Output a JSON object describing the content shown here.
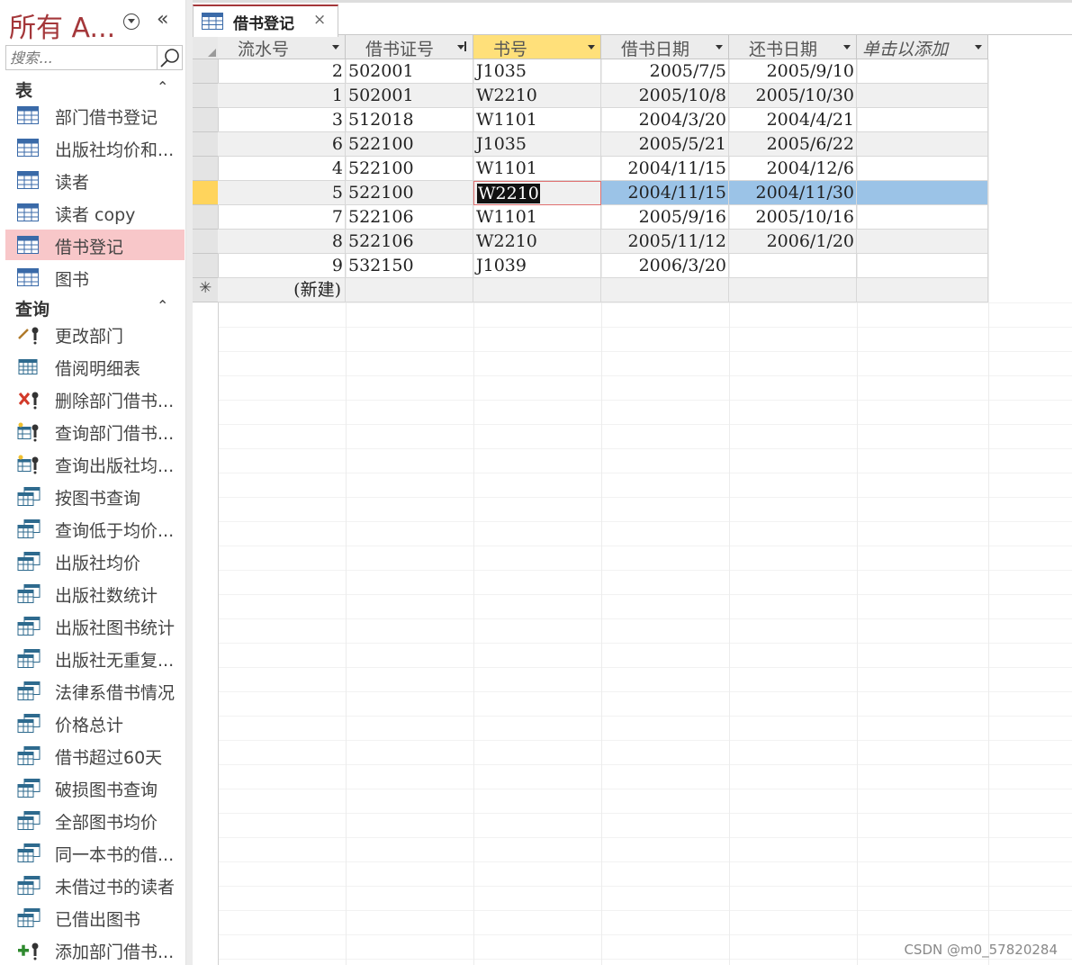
{
  "nav": {
    "title": "所有 A...",
    "search_placeholder": "搜索...",
    "sections": {
      "tables_label": "表",
      "queries_label": "查询"
    },
    "tables": [
      {
        "label": "部门借书登记"
      },
      {
        "label": "出版社均价和..."
      },
      {
        "label": "读者"
      },
      {
        "label": "读者 copy"
      },
      {
        "label": "借书登记",
        "selected": true
      },
      {
        "label": "图书"
      }
    ],
    "queries": [
      {
        "label": "更改部门",
        "icon": "update-query-icon"
      },
      {
        "label": "借阅明细表",
        "icon": "crosstab-query-icon"
      },
      {
        "label": "删除部门借书...",
        "icon": "delete-query-icon"
      },
      {
        "label": "查询部门借书...",
        "icon": "make-table-query-icon"
      },
      {
        "label": "查询出版社均...",
        "icon": "make-table-query-icon"
      },
      {
        "label": "按图书查询",
        "icon": "select-query-icon"
      },
      {
        "label": "查询低于均价...",
        "icon": "select-query-icon"
      },
      {
        "label": "出版社均价",
        "icon": "select-query-icon"
      },
      {
        "label": "出版社数统计",
        "icon": "select-query-icon"
      },
      {
        "label": "出版社图书统计",
        "icon": "select-query-icon"
      },
      {
        "label": "出版社无重复...",
        "icon": "select-query-icon"
      },
      {
        "label": "法律系借书情况",
        "icon": "select-query-icon"
      },
      {
        "label": "价格总计",
        "icon": "select-query-icon"
      },
      {
        "label": "借书超过60天",
        "icon": "select-query-icon"
      },
      {
        "label": "破损图书查询",
        "icon": "select-query-icon"
      },
      {
        "label": "全部图书均价",
        "icon": "select-query-icon"
      },
      {
        "label": "同一本书的借...",
        "icon": "select-query-icon"
      },
      {
        "label": "未借过书的读者",
        "icon": "select-query-icon"
      },
      {
        "label": "已借出图书",
        "icon": "select-query-icon"
      },
      {
        "label": "添加部门借书...",
        "icon": "append-query-icon"
      }
    ]
  },
  "tab": {
    "label": "借书登记",
    "close": "×"
  },
  "datasheet": {
    "columns": [
      "流水号",
      "借书证号",
      "书号",
      "借书日期",
      "还书日期",
      "单击以添加"
    ],
    "rows": [
      [
        "2",
        "502001",
        "J1035",
        "2005/7/5",
        "2005/9/10"
      ],
      [
        "1",
        "502001",
        "W2210",
        "2005/10/8",
        "2005/10/30"
      ],
      [
        "3",
        "512018",
        "W1101",
        "2004/3/20",
        "2004/4/21"
      ],
      [
        "6",
        "522100",
        "J1035",
        "2005/5/21",
        "2005/6/22"
      ],
      [
        "4",
        "522100",
        "W1101",
        "2004/11/15",
        "2004/12/6"
      ],
      [
        "5",
        "522100",
        "W2210",
        "2004/11/15",
        "2004/11/30"
      ],
      [
        "7",
        "522106",
        "W1101",
        "2005/9/16",
        "2005/10/16"
      ],
      [
        "8",
        "522106",
        "W2210",
        "2005/11/12",
        "2006/1/20"
      ],
      [
        "9",
        "532150",
        "J1039",
        "2006/3/20",
        ""
      ]
    ],
    "current_row_index": 5,
    "new_row_label": "(新建)",
    "new_row_marker": "✳"
  },
  "watermark": "CSDN @m0_57820284",
  "colors": {
    "accent": "#a4373a",
    "selected_nav": "#f8c7c9",
    "active_header": "#ffe07a",
    "current_row": "#ffd45c",
    "highlight": "#9bc3e7"
  }
}
